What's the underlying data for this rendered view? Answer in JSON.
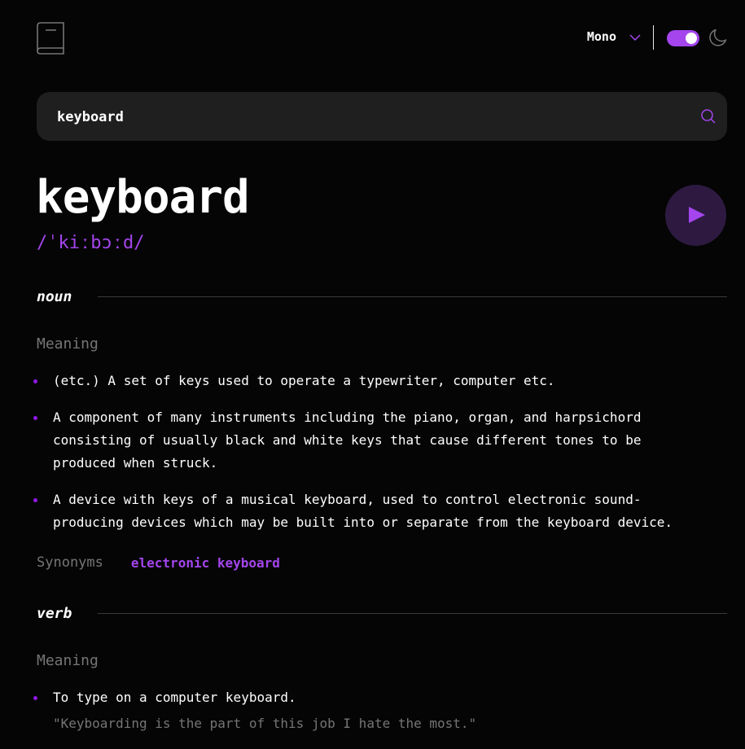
{
  "header": {
    "font_select": {
      "selected": "Mono"
    },
    "theme_toggle": {
      "dark_mode": true
    }
  },
  "search": {
    "value": "keyboard",
    "placeholder": ""
  },
  "entry": {
    "word": "keyboard",
    "phonetic": "/ˈkiːbɔːd/",
    "meanings": [
      {
        "part_of_speech": "noun",
        "meaning_label": "Meaning",
        "definitions": [
          "(etc.) A set of keys used to operate a typewriter, computer etc.",
          "A component of many instruments including the piano, organ, and harpsichord consisting of usually black and white keys that cause different tones to be produced when struck.",
          "A device with keys of a musical keyboard, used to control electronic sound-producing devices which may be built into or separate from the keyboard device."
        ],
        "synonyms_label": "Synonyms",
        "synonyms": [
          "electronic keyboard"
        ]
      },
      {
        "part_of_speech": "verb",
        "meaning_label": "Meaning",
        "definitions": [
          {
            "text": "To type on a computer keyboard.",
            "example": "\"Keyboarding is the part of this job I hate the most.\""
          }
        ]
      }
    ]
  },
  "colors": {
    "accent": "#a445ed",
    "bullet": "#8f19e8",
    "background": "#050505",
    "muted": "#757575",
    "search_bg": "#1f1f1f"
  },
  "icons": [
    "book-logo-icon",
    "chevron-down-icon",
    "moon-icon",
    "search-icon",
    "play-icon"
  ]
}
